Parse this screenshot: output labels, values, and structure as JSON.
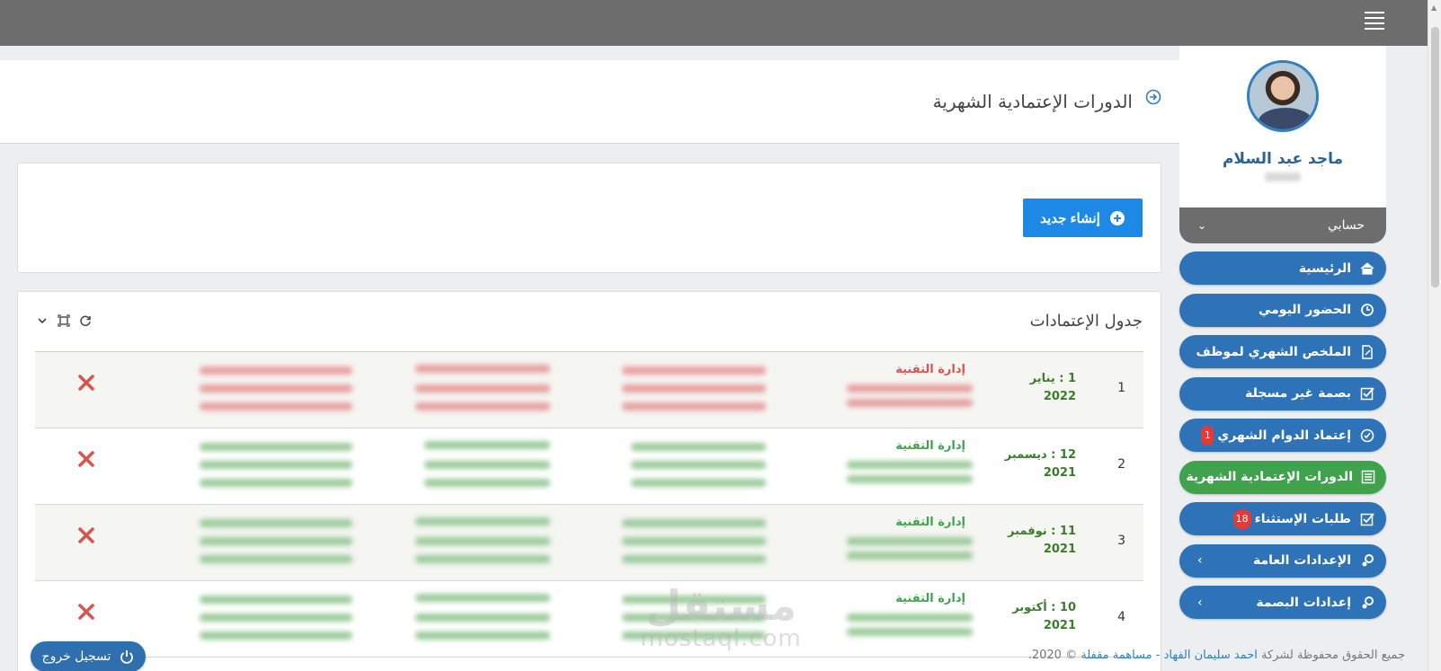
{
  "header": {
    "menu_icon": "hamburger-icon"
  },
  "page": {
    "title": "الدورات الإعتمادية الشهرية",
    "title_icon": "circle-arrow-right-icon"
  },
  "actions": {
    "create_label": "إنشاء جديد",
    "create_icon": "plus-circle-icon"
  },
  "table": {
    "title": "جدول الإعتمادات",
    "tools": [
      "refresh-icon",
      "fullscreen-icon",
      "chevron-down-icon"
    ],
    "rows": [
      {
        "index": "1",
        "month": "1 : يناير\n2022",
        "department": "إدارة التقنية",
        "status_color": "#d9534f"
      },
      {
        "index": "2",
        "month": "12 : ديسمبر\n2021",
        "department": "إدارة التقنية",
        "status_color": "#3fa34d"
      },
      {
        "index": "3",
        "month": "11 : نوفمبر\n2021",
        "department": "إدارة التقنية",
        "status_color": "#3fa34d"
      },
      {
        "index": "4",
        "month": "10 : أكتوبر\n2021",
        "department": "إدارة التقنية",
        "status_color": "#3fa34d"
      }
    ]
  },
  "profile": {
    "name": "ماجد عبد السلام",
    "account_label": "حسابي"
  },
  "nav": {
    "items": [
      {
        "label": "الرئيسية",
        "icon": "home-icon",
        "active": false
      },
      {
        "label": "الحضور اليومي",
        "icon": "history-icon",
        "active": false
      },
      {
        "label": "الملخص الشهري لموظف",
        "icon": "document-edit-icon",
        "active": false
      },
      {
        "label": "بصمة غير مسجلة",
        "icon": "check-square-icon",
        "active": false
      },
      {
        "label": "إعتماد الدوام الشهري",
        "icon": "clock-check-icon",
        "active": false,
        "badge": "1"
      },
      {
        "label": "الدورات الإعتمادية الشهرية",
        "icon": "list-icon",
        "active": true
      },
      {
        "label": "طلبات الإستثناء",
        "icon": "check-square-icon",
        "active": false,
        "badge": "18"
      },
      {
        "label": "الإعدادات العامة",
        "icon": "gears-icon",
        "active": false,
        "arrow": "›"
      },
      {
        "label": "إعدادات البصمة",
        "icon": "gears-icon",
        "active": false,
        "arrow": "›"
      }
    ]
  },
  "footer": {
    "prefix": "جميع الحقوق محفوظة لشركة",
    "company": "احمد سليمان الفهاد - مساهمة مقفلة",
    "suffix": "© 2020."
  },
  "logout": {
    "label": "تسجيل خروج",
    "icon": "power-icon"
  },
  "watermark": {
    "line1": "مستقل",
    "line2": "mostaql.com"
  },
  "colors": {
    "primary": "#2e72b8",
    "active": "#3fa34d",
    "button": "#1e88e5",
    "danger": "#d9534f",
    "topbar": "#6d6d6d"
  }
}
